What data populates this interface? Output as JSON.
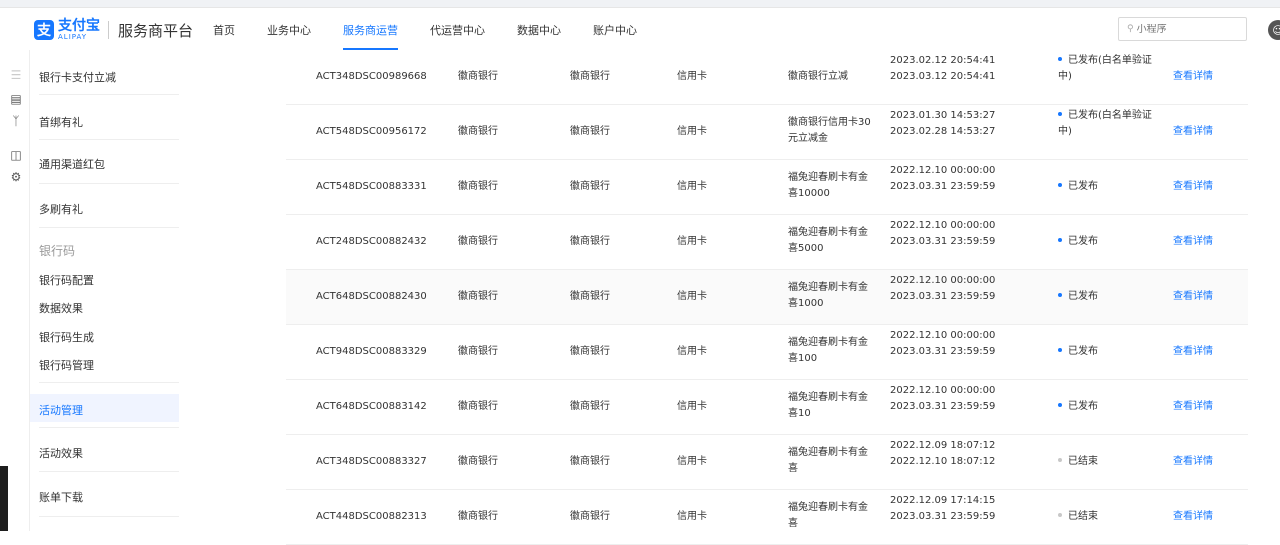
{
  "header": {
    "logo_cn": "支付宝",
    "logo_en": "ALIPAY",
    "platform": "服务商平台",
    "nav": [
      "首页",
      "业务中心",
      "服务商运营",
      "代运营中心",
      "数据中心",
      "账户中心"
    ],
    "active_nav": "服务商运营",
    "search_placeholder": "小程序",
    "accent": "#1677ff"
  },
  "sidebar": {
    "items": [
      "银行卡支付立减",
      "首绑有礼",
      "通用渠道红包",
      "多刷有礼"
    ],
    "group_title": "银行码",
    "group_items": [
      "银行码配置",
      "数据效果",
      "银行码生成",
      "银行码管理"
    ],
    "lower_items": [
      "活动管理",
      "活动效果",
      "账单下载"
    ],
    "active_item": "活动管理"
  },
  "table": {
    "rows": [
      {
        "id": "ACT348DSC00989668",
        "bank1": "徽商银行",
        "bank2": "徽商银行",
        "card": "信用卡",
        "name": "徽商银行立减",
        "start": "2023.02.12 20:54:41",
        "end": "2023.03.12 20:54:41",
        "status": "已发布(白名单验证中)",
        "op": "查看详情"
      },
      {
        "id": "ACT548DSC00956172",
        "bank1": "徽商银行",
        "bank2": "徽商银行",
        "card": "信用卡",
        "name": "徽商银行信用卡30元立减金",
        "start": "2023.01.30 14:53:27",
        "end": "2023.02.28 14:53:27",
        "status": "已发布(白名单验证中)",
        "op": "查看详情"
      },
      {
        "id": "ACT548DSC00883331",
        "bank1": "徽商银行",
        "bank2": "徽商银行",
        "card": "信用卡",
        "name": "福兔迎春刷卡有金喜10000",
        "start": "2022.12.10 00:00:00",
        "end": "2023.03.31 23:59:59",
        "status": "已发布",
        "op": "查看详情"
      },
      {
        "id": "ACT248DSC00882432",
        "bank1": "徽商银行",
        "bank2": "徽商银行",
        "card": "信用卡",
        "name": "福兔迎春刷卡有金喜5000",
        "start": "2022.12.10 00:00:00",
        "end": "2023.03.31 23:59:59",
        "status": "已发布",
        "op": "查看详情"
      },
      {
        "id": "ACT648DSC00882430",
        "bank1": "徽商银行",
        "bank2": "徽商银行",
        "card": "信用卡",
        "name": "福兔迎春刷卡有金喜1000",
        "start": "2022.12.10 00:00:00",
        "end": "2023.03.31 23:59:59",
        "status": "已发布",
        "op": "查看详情"
      },
      {
        "id": "ACT948DSC00883329",
        "bank1": "徽商银行",
        "bank2": "徽商银行",
        "card": "信用卡",
        "name": "福兔迎春刷卡有金喜100",
        "start": "2022.12.10 00:00:00",
        "end": "2023.03.31 23:59:59",
        "status": "已发布",
        "op": "查看详情"
      },
      {
        "id": "ACT648DSC00883142",
        "bank1": "徽商银行",
        "bank2": "徽商银行",
        "card": "信用卡",
        "name": "福兔迎春刷卡有金喜10",
        "start": "2022.12.10 00:00:00",
        "end": "2023.03.31 23:59:59",
        "status": "已发布",
        "op": "查看详情"
      },
      {
        "id": "ACT348DSC00883327",
        "bank1": "徽商银行",
        "bank2": "徽商银行",
        "card": "信用卡",
        "name": "福兔迎春刷卡有金喜",
        "start": "2022.12.09 18:07:12",
        "end": "2022.12.10 18:07:12",
        "status": "已结束",
        "op": "查看详情"
      },
      {
        "id": "ACT448DSC00882313",
        "bank1": "徽商银行",
        "bank2": "徽商银行",
        "card": "信用卡",
        "name": "福兔迎春刷卡有金喜",
        "start": "2022.12.09 17:14:15",
        "end": "2023.03.31 23:59:59",
        "status": "已结束",
        "op": "查看详情"
      }
    ]
  }
}
